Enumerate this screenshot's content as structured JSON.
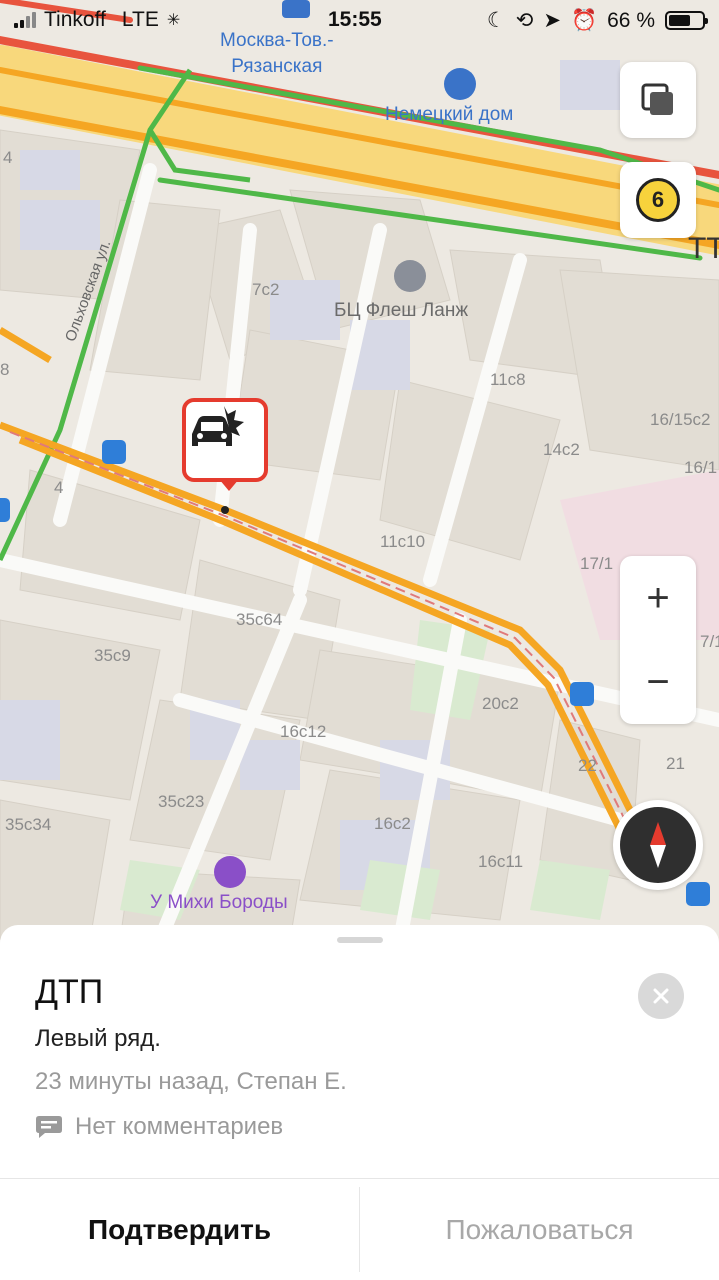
{
  "status_bar": {
    "carrier": "Tinkoff",
    "network": "LTE",
    "time": "15:55",
    "battery": "66 %",
    "battery_level": 0.66
  },
  "map": {
    "labels": {
      "station": "Москва-Тов.-\nРязанская",
      "nemetsky_dom": "Немецкий дом",
      "bc_flesh": "БЦ Флеш Ланж",
      "barber": "У Михи Бороды",
      "street": "Ольховская ул.",
      "ttk": "ТТ",
      "b_7c2": "7с2",
      "b_11c8": "11с8",
      "b_16_15c2": "16/15с2",
      "b_14c2": "14с2",
      "b_16_1": "16/1",
      "b_11c10": "11с10",
      "b_4": "4",
      "b_4b": "4",
      "b_17_1": "17/1",
      "b_35c64": "35с64",
      "b_35c9": "35с9",
      "b_16c12": "16с12",
      "b_20c2": "20с2",
      "b_22": "22",
      "b_21": "21",
      "b_35c23": "35с23",
      "b_35c34": "35с34",
      "b_16c2": "16с2",
      "b_16c11": "16с11",
      "b_7_1": "7/1",
      "b_8": "8"
    },
    "traffic_level": "6"
  },
  "controls": {
    "zoom_in": "+",
    "zoom_out": "−"
  },
  "incident": {
    "title": "ДТП",
    "description": "Левый ряд.",
    "meta": "23 минуты назад, Степан Е.",
    "comments": "Нет комментариев",
    "confirm": "Подтвердить",
    "report": "Пожаловаться"
  },
  "colors": {
    "accent_red": "#e53b2e",
    "traffic_red": "#e8543e",
    "traffic_orange": "#f5a623",
    "traffic_green": "#4fb848"
  }
}
